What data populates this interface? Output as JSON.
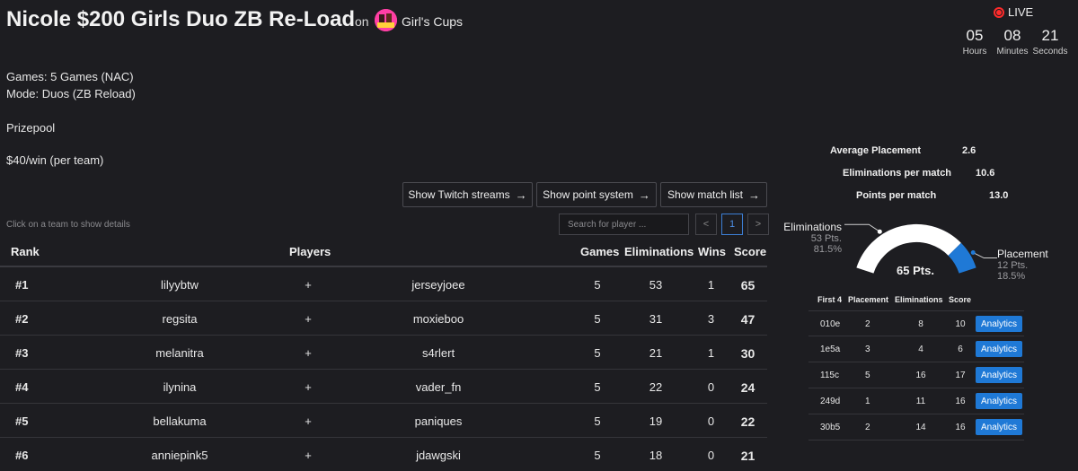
{
  "header": {
    "title": "Nicole $200 Girls Duo ZB Re-Load",
    "on_label": "on",
    "cup_name": "Girl's Cups"
  },
  "live": {
    "label": "LIVE",
    "countdown": [
      {
        "value": "05",
        "label": "Hours"
      },
      {
        "value": "08",
        "label": "Minutes"
      },
      {
        "value": "21",
        "label": "Seconds"
      }
    ]
  },
  "info": {
    "games": "Games: 5 Games (NAC)",
    "mode": "Mode: Duos (ZB Reload)",
    "prizepool_label": "Prizepool",
    "prize": "$40/win (per team)"
  },
  "buttons": {
    "twitch": "Show Twitch streams",
    "points": "Show point system",
    "matches": "Show match list"
  },
  "table_controls": {
    "hint": "Click on a team to show details",
    "search_placeholder": "Search for player ...",
    "page_prev": "<",
    "page_current": "1",
    "page_next": ">"
  },
  "table": {
    "headers": {
      "rank": "Rank",
      "players": "Players",
      "games": "Games",
      "eliminations": "Eliminations",
      "wins": "Wins",
      "score": "Score"
    },
    "rows": [
      {
        "rank": "#1",
        "player1": "lilyybtw",
        "plus": "+",
        "player2": "jerseyjoee",
        "games": "5",
        "eliminations": "53",
        "wins": "1",
        "score": "65"
      },
      {
        "rank": "#2",
        "player1": "regsita",
        "plus": "+",
        "player2": "moxieboo",
        "games": "5",
        "eliminations": "31",
        "wins": "3",
        "score": "47"
      },
      {
        "rank": "#3",
        "player1": "melanitra",
        "plus": "+",
        "player2": "s4rlert",
        "games": "5",
        "eliminations": "21",
        "wins": "1",
        "score": "30"
      },
      {
        "rank": "#4",
        "player1": "ilynina",
        "plus": "+",
        "player2": "vader_fn",
        "games": "5",
        "eliminations": "22",
        "wins": "0",
        "score": "24"
      },
      {
        "rank": "#5",
        "player1": "bellakuma",
        "plus": "+",
        "player2": "paniques",
        "games": "5",
        "eliminations": "19",
        "wins": "0",
        "score": "22"
      },
      {
        "rank": "#6",
        "player1": "anniepink5",
        "plus": "+",
        "player2": "jdawgski",
        "games": "5",
        "eliminations": "18",
        "wins": "0",
        "score": "21"
      }
    ]
  },
  "stats": {
    "avg_placement_label": "Average Placement",
    "avg_placement": "2.6",
    "elims_per_match_label": "Eliminations per match",
    "elims_per_match": "10.6",
    "points_per_match_label": "Points per match",
    "points_per_match": "13.0"
  },
  "gauge": {
    "total": "65 Pts.",
    "elim_label": "Eliminations",
    "elim_pts": "53 Pts.",
    "elim_pct": "81.5%",
    "place_label": "Placement",
    "place_pts": "12 Pts.",
    "place_pct": "18.5%",
    "elim_fraction": 0.815,
    "elim_color": "#ffffff",
    "place_color": "#1f79d6"
  },
  "first4": {
    "headers": {
      "id": "First 4",
      "placement": "Placement",
      "eliminations": "Eliminations",
      "score": "Score"
    },
    "button_label": "Analytics",
    "rows": [
      {
        "id": "010e",
        "placement": "2",
        "eliminations": "8",
        "score": "10"
      },
      {
        "id": "1e5a",
        "placement": "3",
        "eliminations": "4",
        "score": "6"
      },
      {
        "id": "115c",
        "placement": "5",
        "eliminations": "16",
        "score": "17"
      },
      {
        "id": "249d",
        "placement": "1",
        "eliminations": "11",
        "score": "16"
      },
      {
        "id": "30b5",
        "placement": "2",
        "eliminations": "14",
        "score": "16"
      }
    ]
  }
}
